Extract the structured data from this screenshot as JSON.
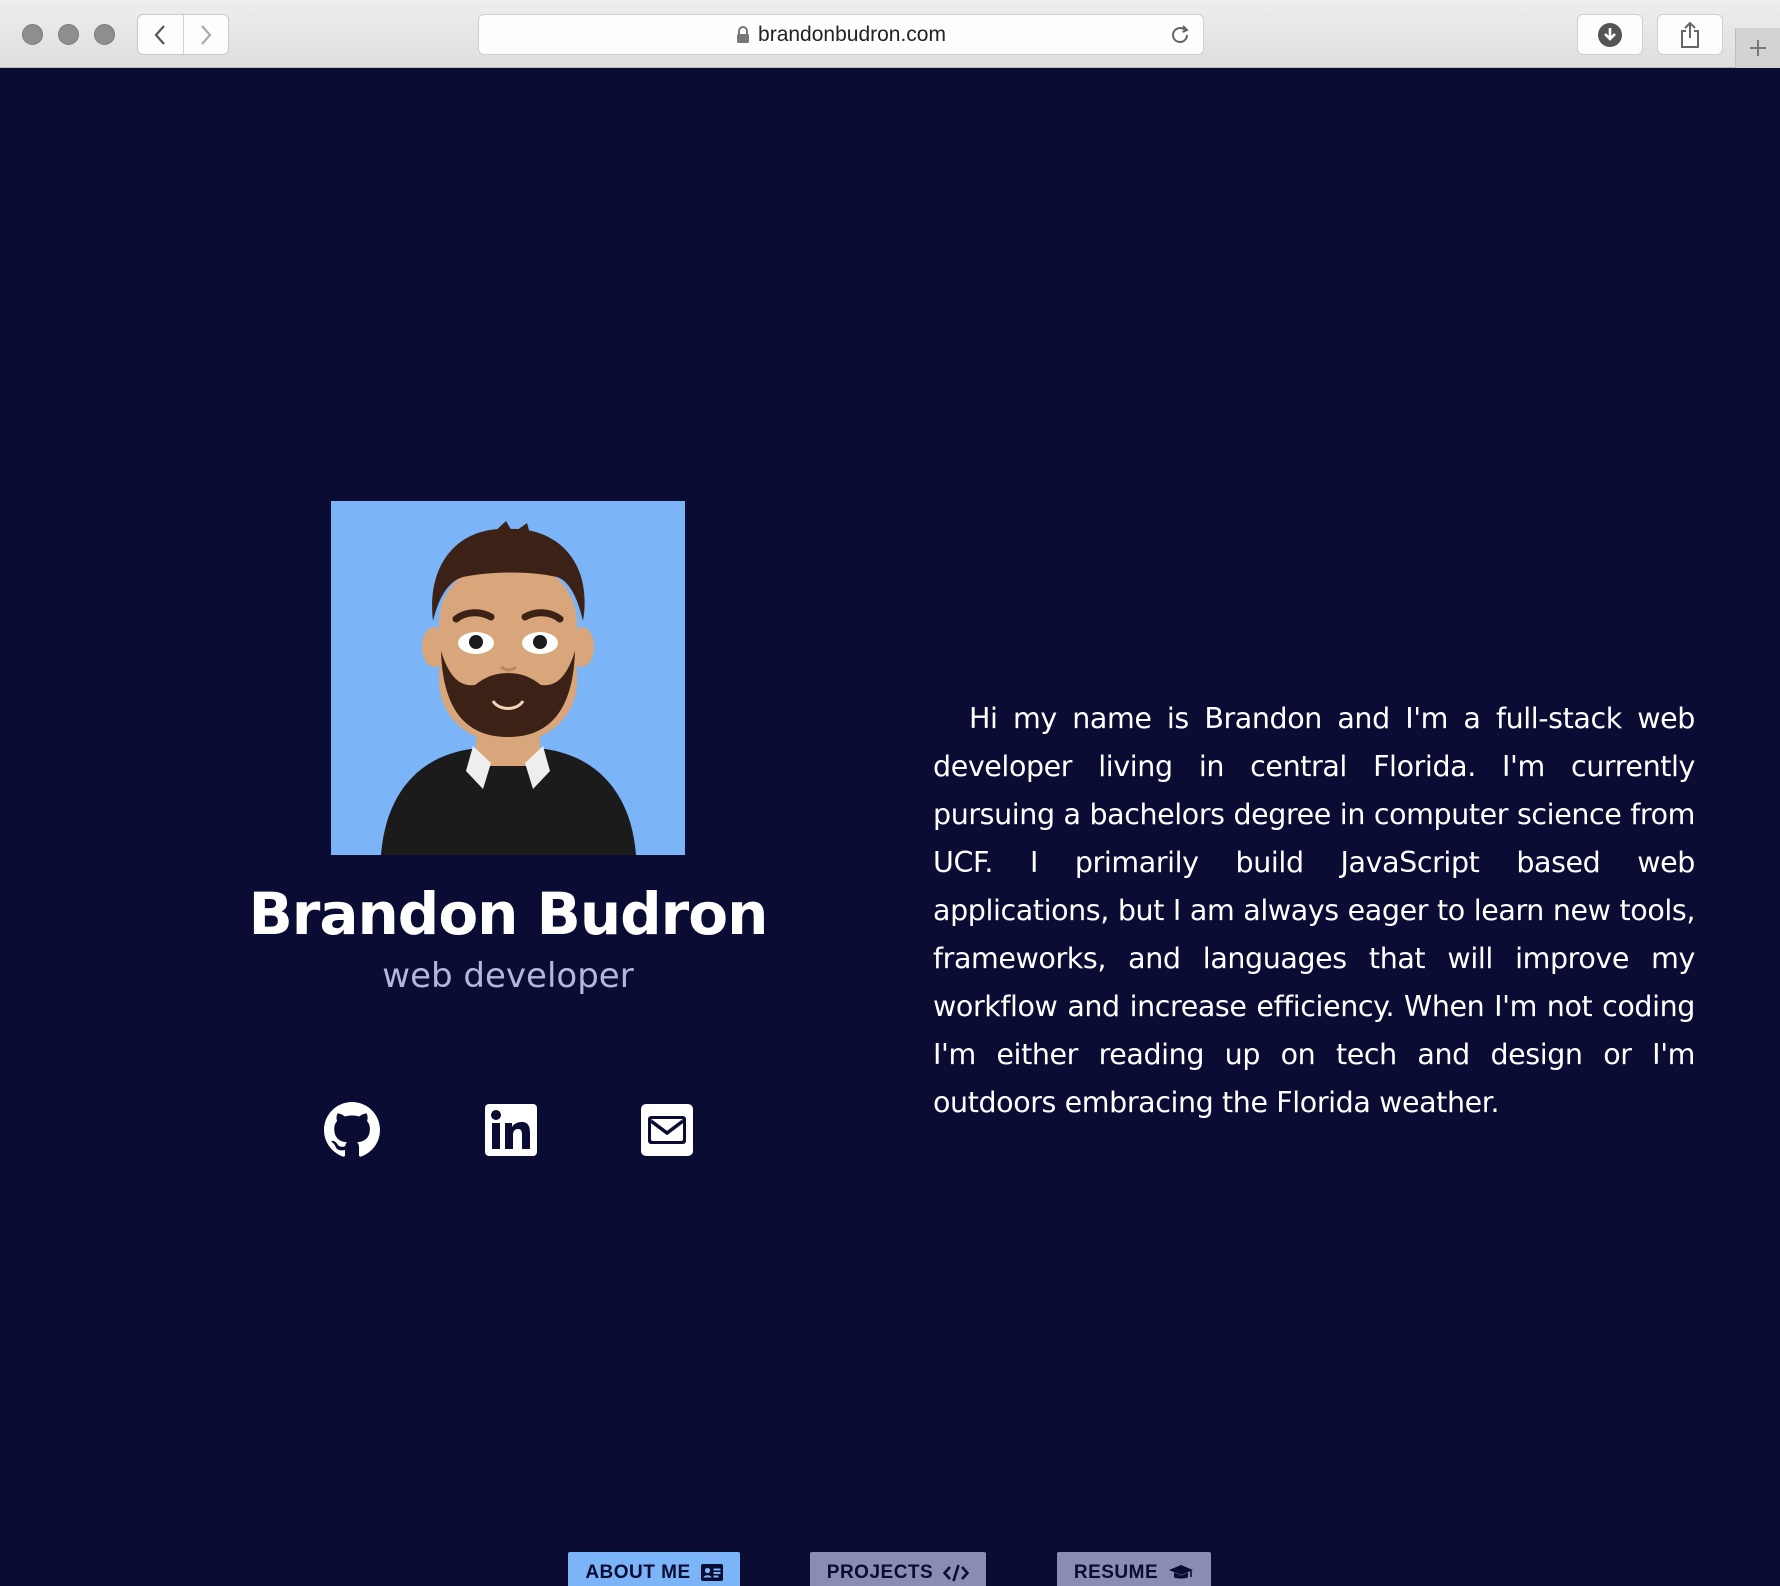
{
  "browser": {
    "url": "brandonbudron.com"
  },
  "profile": {
    "name": "Brandon Budron",
    "title": "web developer",
    "bio": "Hi my name is Brandon and I'm a full-stack web developer living in central Florida. I'm currently pursuing a bachelors degree in computer science from UCF. I primarily build JavaScript based web applications, but I am always eager to learn new tools, frameworks, and languages that will improve my workflow and increase efficiency. When I'm not coding I'm either reading up on tech and design or I'm outdoors embracing the Florida weather."
  },
  "social": [
    {
      "icon": "github-icon"
    },
    {
      "icon": "linkedin-icon"
    },
    {
      "icon": "email-icon"
    }
  ],
  "nav": {
    "about_label": "ABOUT ME",
    "projects_label": "PROJECTS",
    "resume_label": "RESUME"
  },
  "colors": {
    "background": "#0b0c34",
    "accent": "#7cb4f8",
    "muted_button": "#8a8cb6",
    "subtitle": "#b5b6dd"
  }
}
